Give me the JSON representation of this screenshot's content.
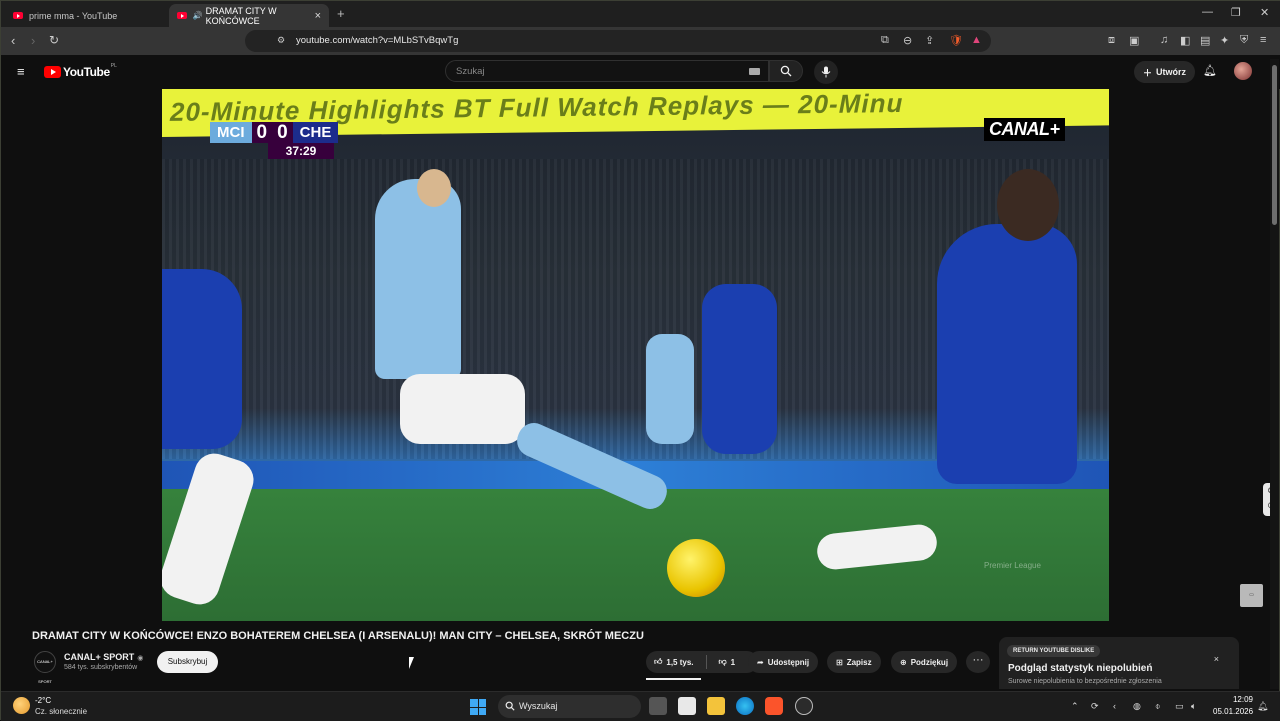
{
  "browser": {
    "tabs": [
      {
        "title": "prime mma - YouTube"
      },
      {
        "title": "DRAMAT CITY W KOŃCÓWCE"
      }
    ],
    "new_tab": "+",
    "url": "youtube.com/watch?v=MLbSTvBqwTg"
  },
  "youtube": {
    "logo": "YouTube",
    "country_code": "PL",
    "search_placeholder": "Szukaj",
    "create_label": "Utwórz"
  },
  "video_overlay": {
    "banner_text": "20-Minute Highlights   BT   Full Watch Replays — 20-Minu",
    "home_team": "MCI",
    "home_score": "0",
    "away_score": "0",
    "away_team": "CHE",
    "clock": "37:29",
    "broadcaster": "CANAL+",
    "watermark": "Premier League"
  },
  "video": {
    "title": "DRAMAT CITY W KOŃCÓWCE! ENZO BOHATEREM CHELSEA (I ARSENALU)! MAN CITY – CHELSEA, SKRÓT MECZU",
    "channel_name": "CANAL+ SPORT",
    "channel_avatar_text": "CANAL+ SPORT",
    "subscribers": "584 tys. subskrybentów",
    "subscribe_label": "Subskrybuj",
    "likes": "1,5 tys.",
    "dislikes": "1",
    "share_label": "Udostępnij",
    "save_label": "Zapisz",
    "thanks_label": "Podziękuj",
    "more_label": "···"
  },
  "return_dislike": {
    "badge": "RETURN YOUTUBE DISLIKE",
    "title": "Podgląd statystyk niepolubień",
    "subtitle": "Surowe niepolubienia to bezpośrednie zgłoszenia",
    "close": "×"
  },
  "taskbar": {
    "temperature": "-2°C",
    "weather": "Cz. słonecznie",
    "search_placeholder": "Wyszukaj",
    "time": "12:09",
    "date": "05.01.2026"
  },
  "colors": {
    "youtube_red": "#ff0000",
    "mci_blue": "#6cabdd",
    "che_blue": "#1c2c8c",
    "pl_purple": "#37003c",
    "banner_yellow": "#e8f23a"
  }
}
